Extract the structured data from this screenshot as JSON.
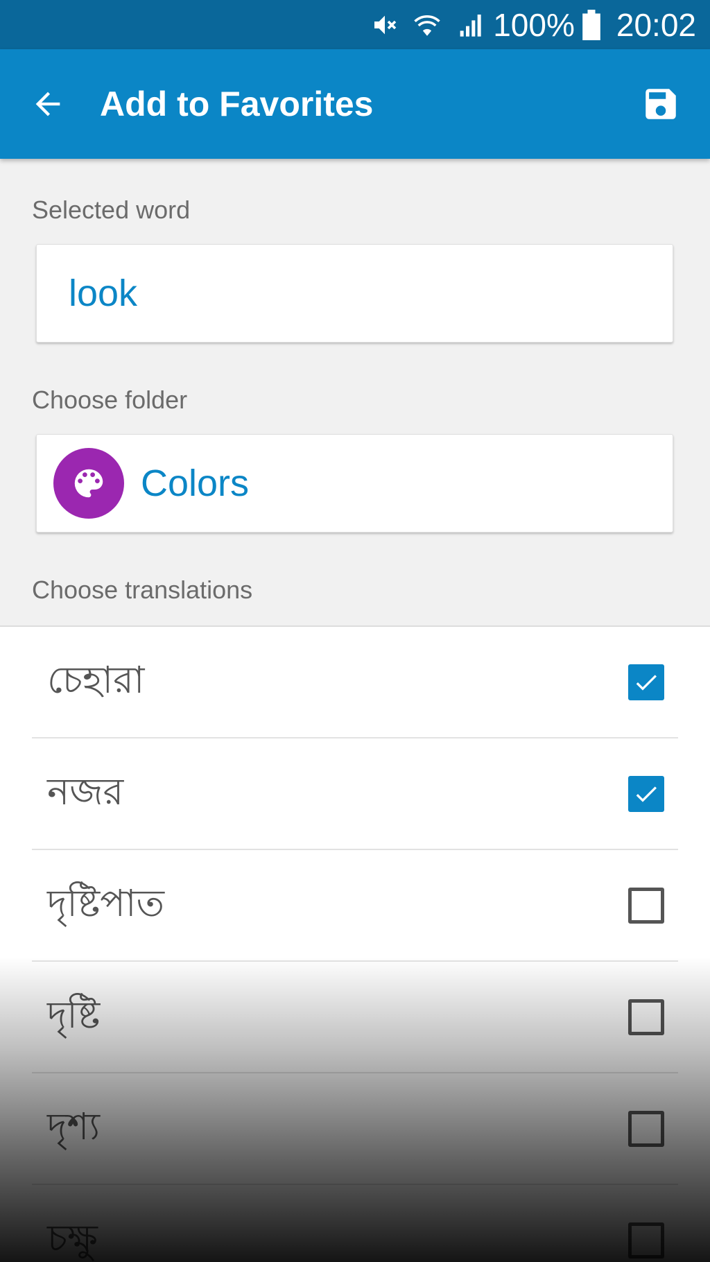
{
  "status_bar": {
    "battery_percent": "100%",
    "time": "20:02",
    "icons": [
      "mute-icon",
      "wifi-icon",
      "signal-icon",
      "battery-icon"
    ]
  },
  "app_bar": {
    "title": "Add to Favorites",
    "back_icon": "arrow-left-icon",
    "save_icon": "save-icon",
    "color": "#0b86c6"
  },
  "selected_word": {
    "label": "Selected word",
    "value": "look"
  },
  "folder": {
    "label": "Choose folder",
    "name": "Colors",
    "icon": "palette-icon",
    "icon_bg": "#9b27b0"
  },
  "translations": {
    "label": "Choose translations",
    "items": [
      {
        "text": "চেহারা",
        "checked": true
      },
      {
        "text": "নজর",
        "checked": true
      },
      {
        "text": "দৃষ্টিপাত",
        "checked": false
      },
      {
        "text": "দৃষ্টি",
        "checked": false
      },
      {
        "text": "দৃশ্য",
        "checked": false
      },
      {
        "text": "চক্ষু",
        "checked": false
      }
    ]
  }
}
